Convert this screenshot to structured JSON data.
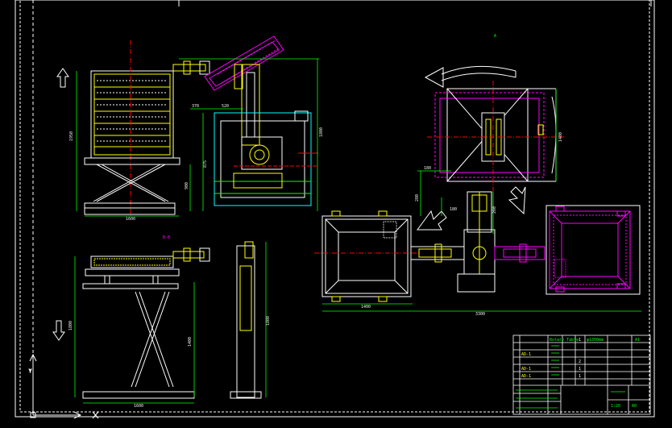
{
  "colors": {
    "background": "#000000",
    "frame": "#ffffff",
    "cyan": "#00ffff",
    "yellow": "#ffff00",
    "magenta": "#ff00ff",
    "green": "#00ff00",
    "red": "#ff0000",
    "white": "#ffffff"
  },
  "icons": [
    "arrow-up-icon",
    "arrow-down-icon",
    "rotation-arrow-icon",
    "ucs-icon"
  ],
  "labels": {
    "top_plan_mark": "A",
    "section_label": "B-B"
  },
  "dimensions": {
    "elev_height_left": "1950",
    "elev_width_bottom": "1600",
    "scissor_height": "900",
    "slider_260": "260",
    "arm_height": "875",
    "post_width": "370",
    "post_width2": "520",
    "mast_height": "1800",
    "table_height": "1400",
    "lower_height": "1800",
    "lower_base": "1600",
    "lower_mast": "1800",
    "plan_180": "180",
    "plan_280": "280",
    "plan_180b": "180",
    "plan_height": "1400",
    "plan_width_left": "1400",
    "plan_total": "3300"
  },
  "title_block": {
    "row1_name": "Rotary Table",
    "row1_spec": "φ1300mm",
    "row1_qty": "1",
    "row1_note": "A1",
    "row2_code": "AD-1",
    "row3_code": "AD-1",
    "row3_qty": "2",
    "row4_qty": "1",
    "row5_code": "AD-1",
    "row5_qty": "1",
    "scale": "1:20",
    "sheet": "A0"
  }
}
